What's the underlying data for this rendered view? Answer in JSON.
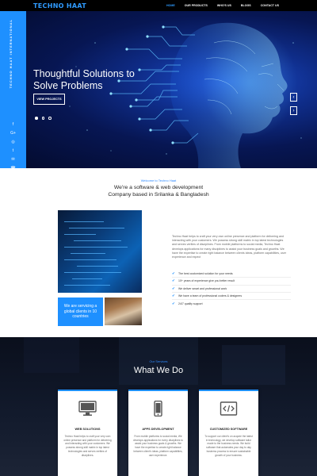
{
  "brand": {
    "logo": "TECHNO HAAT",
    "accent": "#1e90ff",
    "dark": "#000000"
  },
  "nav": {
    "items": [
      "HOME",
      "OUR PRODUCTS",
      "WHO'S US",
      "BLOGS",
      "CONTACT US"
    ],
    "active": "HOME"
  },
  "hero": {
    "side_title": "TECHNO HAAT INTERNATIONAL",
    "social_icons": [
      "facebook-icon",
      "google-plus-icon",
      "instagram-icon",
      "twitter-icon",
      "email-icon",
      "phone-icon",
      "location-icon"
    ],
    "social_glyphs": [
      "f",
      "G+",
      "◎",
      "t",
      "✉",
      "☎",
      "⌂"
    ],
    "title": "Thoughtful Solutions to Solve Problems",
    "button": "VIEW PROJECTS",
    "slides": 3,
    "active_slide": 1,
    "prev_glyph": "‹",
    "next_glyph": "›"
  },
  "about": {
    "eyebrow": "Welcome to Techno Haat",
    "heading_line1": "We're a software & web development",
    "heading_line2": "Company based in Srilanka & Bangladesh",
    "card": "We are servicing a global clients in 10 countries",
    "body": "Techno Haat helps to craft your very own online presence and platform for delivering and interacting with your customers. We possess strong skill matrix in top latest technologies and serves verities of disciplines. From mobile platforms to social media, Techno Haat develops applications for many disciplines to assist your business goals and growths. We have the expertise to create right balance between clients ideas, platform capabilities, user experience and expect",
    "checklist": [
      "The best customized solution for your needs",
      "10+ years of experience give you better result",
      "We deliver smart and professional work",
      "We have a team of professional coders & designers",
      "24/7 quality support"
    ]
  },
  "services": {
    "eyebrow": "Our Services",
    "title": "What We Do",
    "cards": [
      {
        "icon": "monitor-icon",
        "title": "WEB SOLUTIONS",
        "text": "Techno Haat helps to craft your very own online presence and platform for delivering and interacting with your customers. We possess strong skill matrix in top latest technologies and serves verities of disciplines."
      },
      {
        "icon": "mobile-icon",
        "title": "APPS DEVELOPMENT",
        "text": "From mobile platforms to social media, We develops applications for every disciplines to assist your business goals & growths. We have the expertise to create right balance between client's ideas, platform capabilities, user experience."
      },
      {
        "icon": "code-icon",
        "title": "CUSTOMIZED SOFTWARE",
        "text": "To support our client's on acquire the latest in technology, we develop software tailor made to the business needs. We build software that automates your day to day business process to ensure sustainable growth of your business."
      }
    ]
  }
}
